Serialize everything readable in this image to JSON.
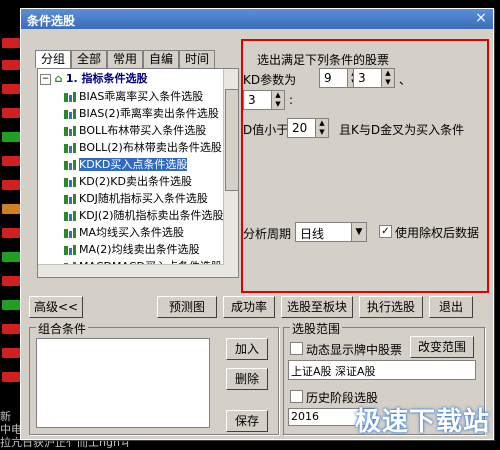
{
  "window": {
    "title": "条件选股",
    "close_glyph": "×"
  },
  "tabs": [
    "分组",
    "全部",
    "常用",
    "自编",
    "时间"
  ],
  "tree": {
    "root": "1. 指标条件选股",
    "items": [
      "BIAS乖离率买入条件选股",
      "BIAS(2)乖离率卖出条件选股",
      "BOLL布林带买入条件选股",
      "BOLL(2)布林带卖出条件选股",
      "KDKD买入点条件选股",
      "KD(2)KD卖出条件选股",
      "KDJ随机指标买入条件选股",
      "KDJ(2)随机指标卖出条件选股",
      "MA均线买入条件选股",
      "MA(2)均线卖出条件选股",
      "MACDMACD买入点条件选股",
      "MACD(2)MACD卖出点条件选股"
    ],
    "selected_index": 4
  },
  "panel": {
    "heading": "选出满足下列条件的股票",
    "kd_param_label": "KD参数为",
    "p1": "9",
    "p2": "3",
    "p3": "3",
    "sep": "、",
    "colon": ":",
    "d_label": "D值小于",
    "d_value": "20",
    "d_suffix": "且K与D金叉为买入条件",
    "period_label": "分析周期",
    "period_value": "日线",
    "use_adjusted_label": "使用除权后数据",
    "use_adjusted_checked": "✓"
  },
  "buttons": {
    "advanced": "高级<<",
    "preview": "预测图",
    "success_rate": "成功率",
    "to_block": "选股至板块",
    "run": "执行选股",
    "exit": "退出",
    "add": "加入",
    "delete": "删除",
    "save": "保存",
    "change_range": "改变范围"
  },
  "combo": {
    "title": "组合条件"
  },
  "range": {
    "title": "选股范围",
    "dynamic_label": "动态显示牌中股票",
    "markets": "上证A股 深证A股",
    "history_label": "历史阶段选股",
    "date_partial": "2016"
  },
  "background_text": {
    "line1": "新",
    "line2": "中电子MNT",
    "line3": "拉亢日获沪正亻而工ngnㄐ"
  },
  "watermark": "极速下载站"
}
